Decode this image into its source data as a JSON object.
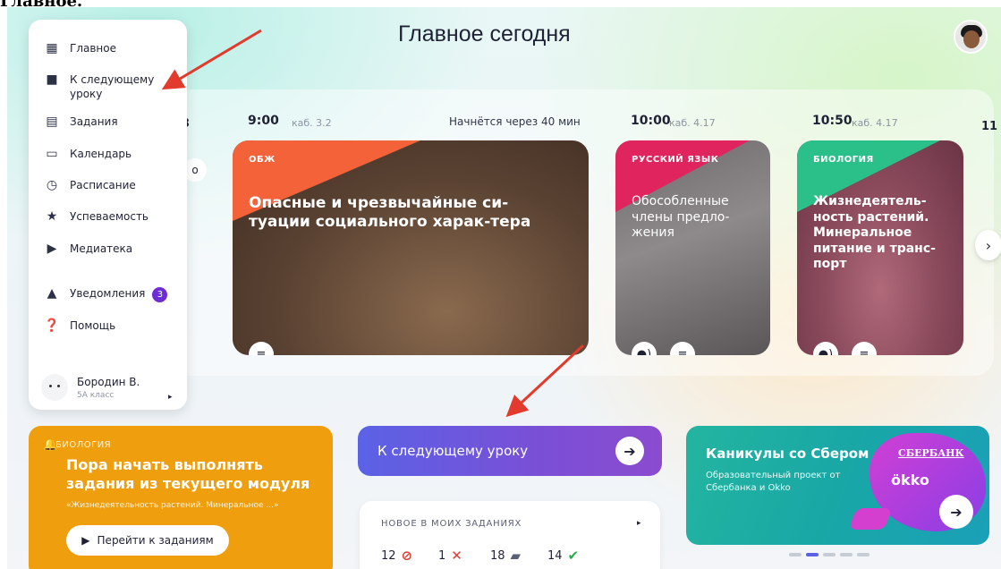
{
  "top_crop_text": "Главное.",
  "page_title": "Главное сегодня",
  "sidebar": {
    "items": [
      {
        "label": "Главное",
        "icon": "grid-icon"
      },
      {
        "label": "К следующему уроку",
        "icon": "briefcase-icon"
      },
      {
        "label": "Задания",
        "icon": "clipboard-icon"
      },
      {
        "label": "Календарь",
        "icon": "calendar-icon"
      },
      {
        "label": "Расписание",
        "icon": "clock-icon"
      },
      {
        "label": "Успеваемость",
        "icon": "star-icon"
      },
      {
        "label": "Медиатека",
        "icon": "media-icon"
      },
      {
        "label": "Уведомления",
        "icon": "bell-icon",
        "badge": "3"
      },
      {
        "label": "Помощь",
        "icon": "help-icon"
      }
    ],
    "user": {
      "name": "Бородин В.",
      "class": "5А класс"
    }
  },
  "schedule": {
    "partial_left_time": "3",
    "partial_left_button": "о",
    "starts_in": "Начнётся через 40 мин",
    "edge_time": "11",
    "lessons": [
      {
        "time": "9:00",
        "room": "каб. 3.2",
        "subject": "ОБЖ",
        "title": "Опасные и чрезвычайные си-туации социального харак-тера",
        "accent": "#f4623a"
      },
      {
        "time": "10:00",
        "room": "каб. 4.17",
        "subject": "РУССКИЙ ЯЗЫК",
        "title": "Обособленные члены предло-жения",
        "accent": "#e0245e"
      },
      {
        "time": "10:50",
        "room": "каб. 4.17",
        "subject": "БИОЛОГИЯ",
        "title": "Жизнедеятель-ность растений. Минеральное питание и транс-порт",
        "accent": "#2bbf8a"
      }
    ]
  },
  "bio_card": {
    "tag": "БИОЛОГИЯ",
    "title": "Пора начать выполнять задания из текущего модуля",
    "subtitle": "«Жизнедеятельность растений. Минеральное ...»",
    "button": "Перейти к заданиям",
    "color": "#ef9e0d"
  },
  "next_lesson_button": "К следующему уроку",
  "tasks": {
    "header": "НОВОЕ В МОИХ ЗАДАНИЯХ",
    "stats": [
      {
        "count": "12",
        "icon": "overdue-icon"
      },
      {
        "count": "1",
        "icon": "cross-icon"
      },
      {
        "count": "18",
        "icon": "comment-icon"
      },
      {
        "count": "14",
        "icon": "check-icon"
      }
    ]
  },
  "promo": {
    "title": "Каникулы со Сбером",
    "subtitle": "Образовательный проект от Сбербанка и Okko",
    "brand1": "СБЕРБАНК",
    "brand2": "ökko"
  },
  "colors": {
    "purple": "#6d2cd6",
    "orange": "#ef9e0d",
    "teal": "#1aa0a6",
    "arrow": "#e23b2e"
  }
}
